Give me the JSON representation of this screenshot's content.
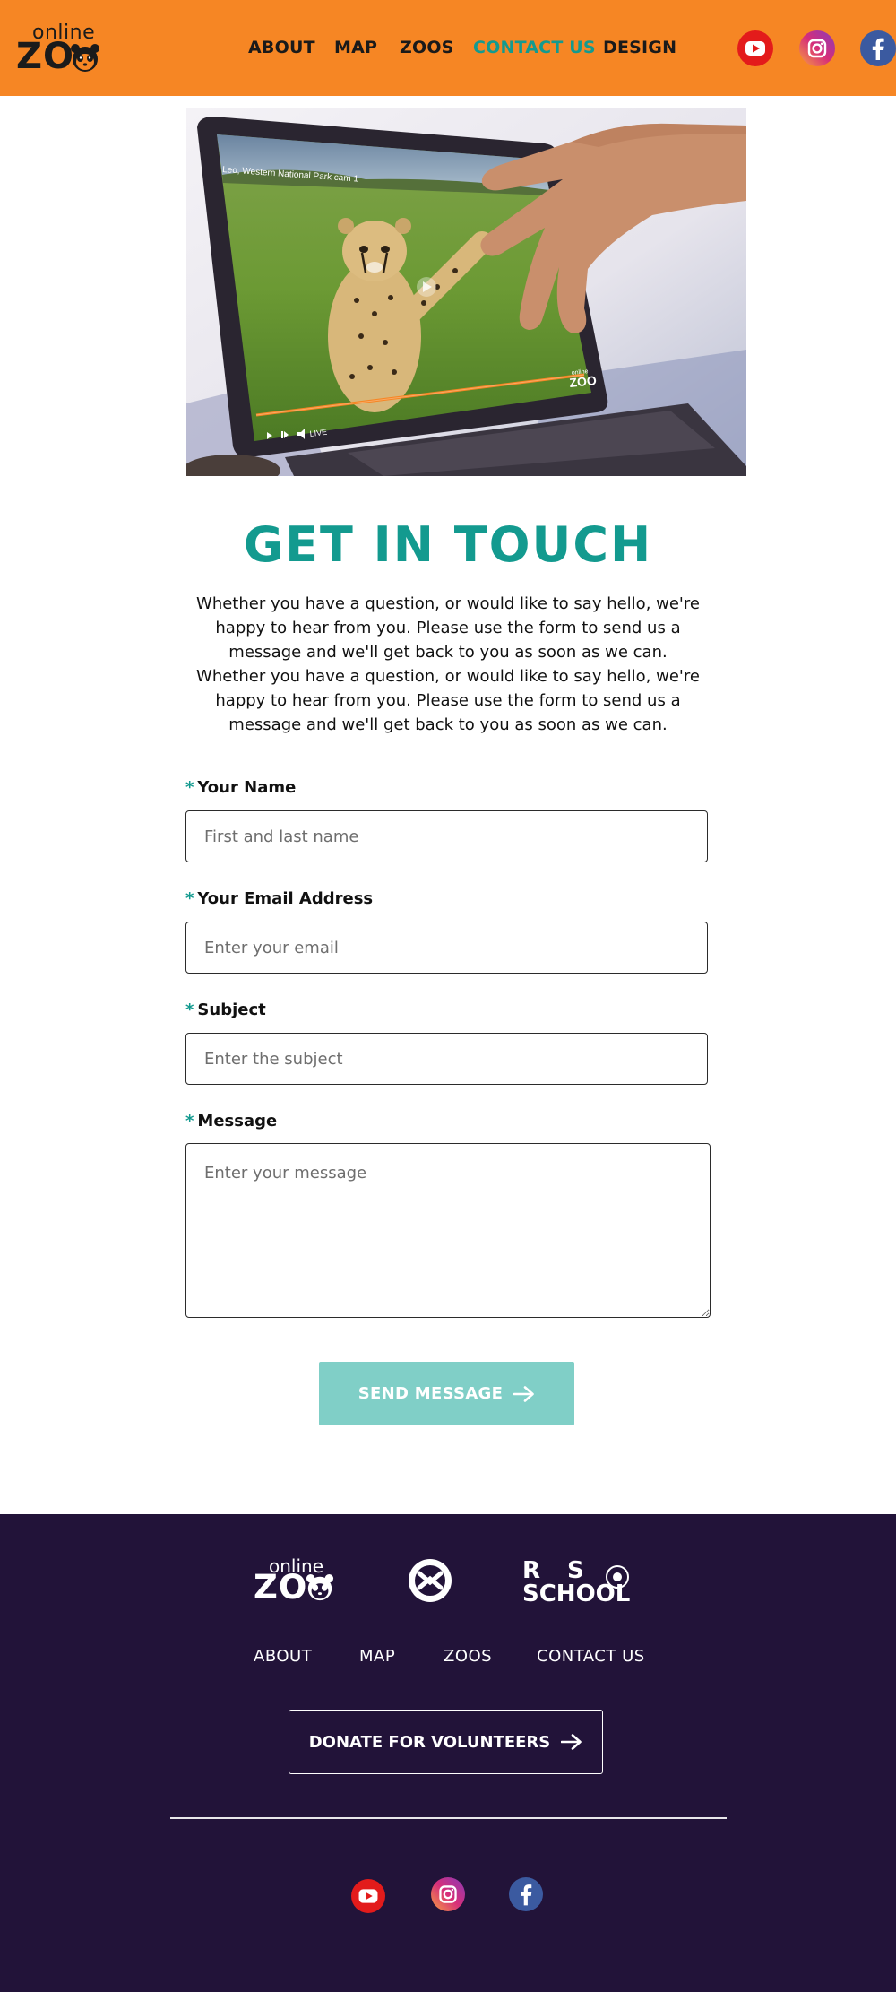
{
  "header": {
    "logo": {
      "top": "online",
      "bottom": "ZO"
    },
    "nav": [
      {
        "label": "ABOUT",
        "active": false
      },
      {
        "label": "MAP",
        "active": false
      },
      {
        "label": "ZOOS",
        "active": false
      },
      {
        "label": "CONTACT US",
        "active": true
      },
      {
        "label": "DESIGN",
        "active": false
      }
    ],
    "social": [
      "youtube-icon",
      "instagram-icon",
      "facebook-icon"
    ]
  },
  "hero": {
    "video_caption": "Leo, Western National Park cam 1",
    "player_status": "LIVE",
    "watermark_top": "online",
    "watermark_bottom": "ZOO"
  },
  "contact": {
    "title": "GET IN TOUCH",
    "intro": "Whether you have a question, or would like to say hello, we're happy to hear from you. Please use the form to send us a message and we'll get back to you as soon as we can. Whether you have a question, or would like to say hello, we're happy to hear from you. Please use the form to send us a message and we'll get back to you as soon as we can.",
    "required_mark": "*",
    "fields": [
      {
        "label": "Your Name",
        "placeholder": "First and last name",
        "value": ""
      },
      {
        "label": "Your Email Address",
        "placeholder": "Enter your email",
        "value": ""
      },
      {
        "label": "Subject",
        "placeholder": "Enter the subject",
        "value": ""
      },
      {
        "label": "Message",
        "placeholder": "Enter your message",
        "value": ""
      }
    ],
    "submit_label": "SEND MESSAGE"
  },
  "footer": {
    "logos": {
      "zoo_top": "online",
      "zoo_bottom": "ZO",
      "school_line1": "RS",
      "school_line2": "SCHOOL"
    },
    "nav": [
      "ABOUT",
      "MAP",
      "ZOOS",
      "CONTACT US"
    ],
    "donate_label": "DONATE FOR VOLUNTEERS",
    "social": [
      "youtube-icon",
      "instagram-icon",
      "facebook-icon"
    ]
  },
  "colors": {
    "header_bg": "#f68624",
    "accent": "#139a8f",
    "button_bg": "#80cfc7",
    "footer_bg": "#221339"
  }
}
